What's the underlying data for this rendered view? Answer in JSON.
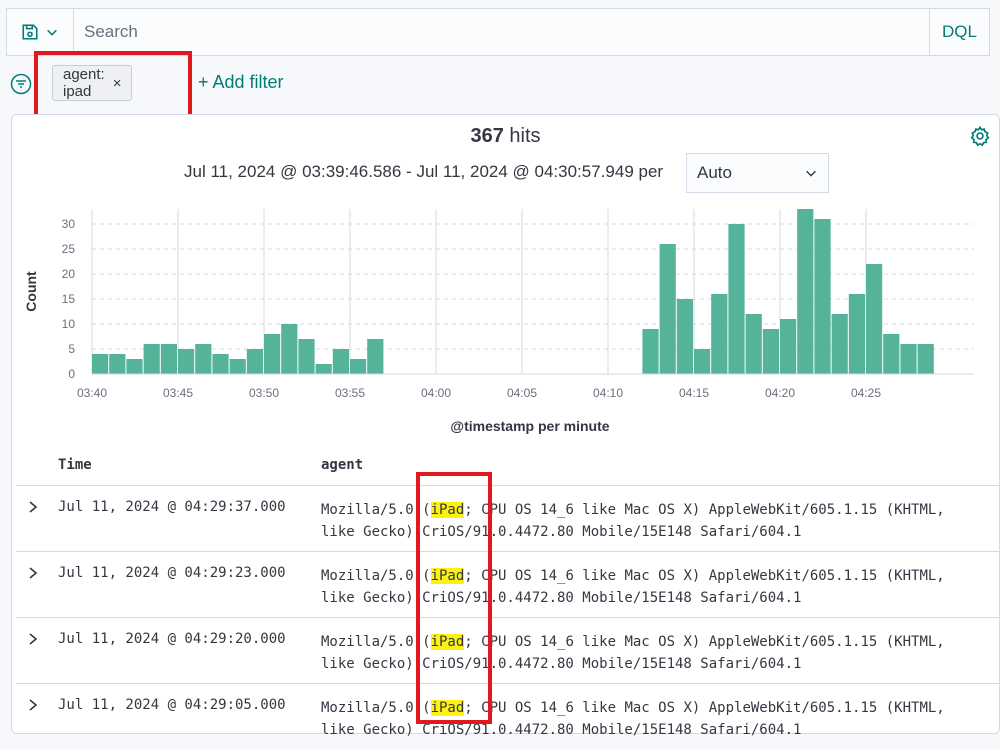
{
  "search": {
    "placeholder": "Search",
    "language": "DQL"
  },
  "filters": {
    "pill_label": "agent: ipad",
    "close": "×",
    "add_label": "+ Add filter"
  },
  "summary": {
    "hits_count": "367",
    "hits_label": "hits",
    "range_text": "Jul 11, 2024 @ 03:39:46.586 - Jul 11, 2024 @ 04:30:57.949 per",
    "interval_value": "Auto"
  },
  "chart_data": {
    "type": "bar",
    "ylabel": "Count",
    "xlabel": "@timestamp per minute",
    "ylim": [
      0,
      33
    ],
    "yticks": [
      0,
      5,
      10,
      15,
      20,
      25,
      30
    ],
    "xticks": [
      "03:40",
      "03:45",
      "03:50",
      "03:55",
      "04:00",
      "04:05",
      "04:10",
      "04:15",
      "04:20",
      "04:25"
    ],
    "x_start": "03:40",
    "x_step_minutes": 1,
    "values": [
      4,
      4,
      3,
      6,
      6,
      5,
      6,
      4,
      3,
      5,
      8,
      10,
      7,
      2,
      5,
      3,
      7,
      0,
      0,
      0,
      0,
      0,
      0,
      0,
      0,
      0,
      0,
      0,
      0,
      0,
      0,
      0,
      9,
      26,
      15,
      5,
      16,
      30,
      12,
      9,
      11,
      33,
      31,
      12,
      16,
      22,
      8,
      6,
      6
    ],
    "color": "#54b399"
  },
  "table": {
    "headers": {
      "time": "Time",
      "agent": "agent"
    },
    "rows": [
      {
        "time": "Jul 11, 2024 @ 04:29:37.000",
        "agent_pre": "Mozilla/5.0 (",
        "agent_match": "iPad",
        "agent_post": "; CPU OS 14_6 like Mac OS X) AppleWebKit/605.1.15 (KHTML, like Gecko) CriOS/91.0.4472.80 Mobile/15E148 Safari/604.1"
      },
      {
        "time": "Jul 11, 2024 @ 04:29:23.000",
        "agent_pre": "Mozilla/5.0 (",
        "agent_match": "iPad",
        "agent_post": "; CPU OS 14_6 like Mac OS X) AppleWebKit/605.1.15 (KHTML, like Gecko) CriOS/91.0.4472.80 Mobile/15E148 Safari/604.1"
      },
      {
        "time": "Jul 11, 2024 @ 04:29:20.000",
        "agent_pre": "Mozilla/5.0 (",
        "agent_match": "iPad",
        "agent_post": "; CPU OS 14_6 like Mac OS X) AppleWebKit/605.1.15 (KHTML, like Gecko) CriOS/91.0.4472.80 Mobile/15E148 Safari/604.1"
      },
      {
        "time": "Jul 11, 2024 @ 04:29:05.000",
        "agent_pre": "Mozilla/5.0 (",
        "agent_match": "iPad",
        "agent_post": "; CPU OS 14_6 like Mac OS X) AppleWebKit/605.1.15 (KHTML, like Gecko) CriOS/91.0.4472.80 Mobile/15E148 Safari/604.1"
      }
    ]
  },
  "colors": {
    "accent": "#017d73",
    "highlight_box": "#e0191f",
    "match": "#fcf113"
  }
}
